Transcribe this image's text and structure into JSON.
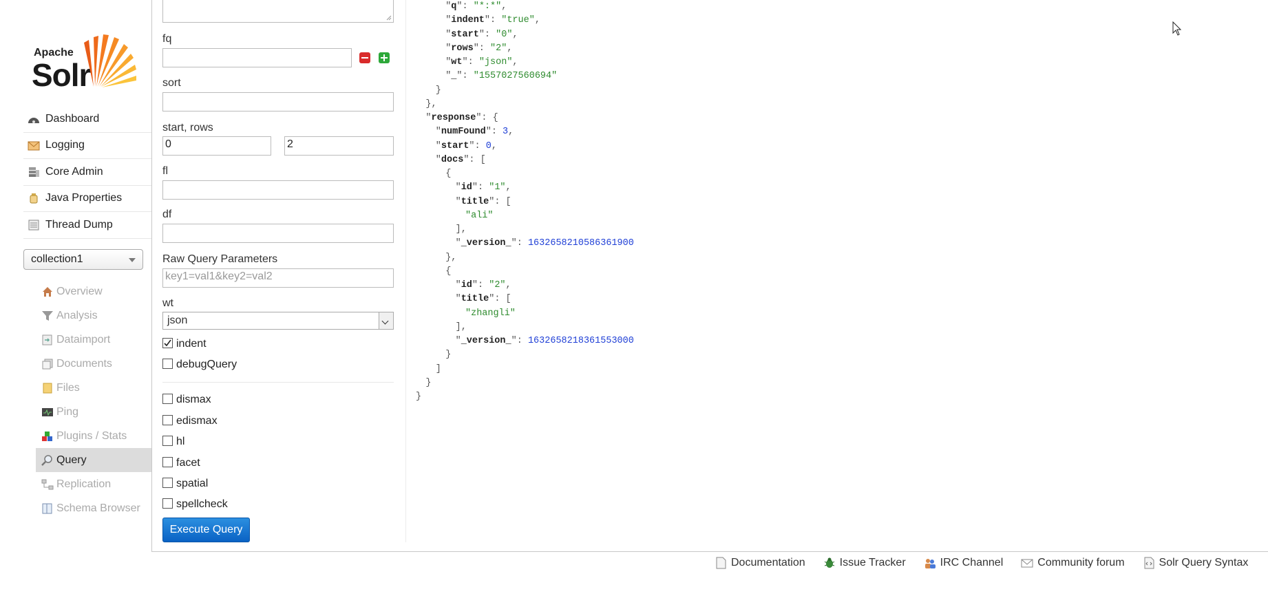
{
  "logo": {
    "line1": "Apache",
    "line2": "Solr"
  },
  "main_nav": [
    {
      "label": "Dashboard",
      "icon": "dashboard-icon"
    },
    {
      "label": "Logging",
      "icon": "logging-icon"
    },
    {
      "label": "Core Admin",
      "icon": "core-admin-icon"
    },
    {
      "label": "Java Properties",
      "icon": "java-properties-icon"
    },
    {
      "label": "Thread Dump",
      "icon": "thread-dump-icon"
    }
  ],
  "core_selector": {
    "value": "collection1"
  },
  "core_menu": [
    {
      "label": "Overview",
      "icon": "home-icon",
      "active": false
    },
    {
      "label": "Analysis",
      "icon": "funnel-icon",
      "active": false
    },
    {
      "label": "Dataimport",
      "icon": "dataimport-icon",
      "active": false
    },
    {
      "label": "Documents",
      "icon": "documents-icon",
      "active": false
    },
    {
      "label": "Files",
      "icon": "files-icon",
      "active": false
    },
    {
      "label": "Ping",
      "icon": "ping-icon",
      "active": false
    },
    {
      "label": "Plugins / Stats",
      "icon": "plugins-icon",
      "active": false
    },
    {
      "label": "Query",
      "icon": "magnifier-icon",
      "active": true
    },
    {
      "label": "Replication",
      "icon": "replication-icon",
      "active": false
    },
    {
      "label": "Schema Browser",
      "icon": "schema-icon",
      "active": false
    }
  ],
  "form": {
    "fq_label": "fq",
    "fq_value": "",
    "sort_label": "sort",
    "sort_value": "",
    "start_rows_label": "start, rows",
    "start_value": "0",
    "rows_value": "2",
    "fl_label": "fl",
    "fl_value": "",
    "df_label": "df",
    "df_value": "",
    "raw_label": "Raw Query Parameters",
    "raw_placeholder": "key1=val1&key2=val2",
    "wt_label": "wt",
    "wt_value": "json",
    "checkboxes": [
      {
        "label": "indent",
        "checked": true
      },
      {
        "label": "debugQuery",
        "checked": false
      }
    ],
    "options": [
      {
        "label": "dismax",
        "checked": false
      },
      {
        "label": "edismax",
        "checked": false
      },
      {
        "label": "hl",
        "checked": false
      },
      {
        "label": "facet",
        "checked": false
      },
      {
        "label": "spatial",
        "checked": false
      },
      {
        "label": "spellcheck",
        "checked": false
      }
    ],
    "execute_label": "Execute Query"
  },
  "response_lines": [
    {
      "indent": 3,
      "k": "q",
      "v": "\"*:*\"",
      "vt": "s",
      "tail": ","
    },
    {
      "indent": 3,
      "k": "indent",
      "v": "\"true\"",
      "vt": "s",
      "tail": ","
    },
    {
      "indent": 3,
      "k": "start",
      "v": "\"0\"",
      "vt": "s",
      "tail": ","
    },
    {
      "indent": 3,
      "k": "rows",
      "v": "\"2\"",
      "vt": "s",
      "tail": ","
    },
    {
      "indent": 3,
      "k": "wt",
      "v": "\"json\"",
      "vt": "s",
      "tail": ","
    },
    {
      "indent": 3,
      "k": "_",
      "v": "\"1557027560694\"",
      "vt": "s",
      "tail": ""
    },
    {
      "indent": 2,
      "raw": "}"
    },
    {
      "indent": 1,
      "raw": "},"
    },
    {
      "indent": 1,
      "k": "response",
      "v": "{",
      "vt": "p",
      "tail": ""
    },
    {
      "indent": 2,
      "k": "numFound",
      "v": "3",
      "vt": "n",
      "tail": ","
    },
    {
      "indent": 2,
      "k": "start",
      "v": "0",
      "vt": "n",
      "tail": ","
    },
    {
      "indent": 2,
      "k": "docs",
      "v": "[",
      "vt": "p",
      "tail": ""
    },
    {
      "indent": 3,
      "raw": "{"
    },
    {
      "indent": 4,
      "k": "id",
      "v": "\"1\"",
      "vt": "s",
      "tail": ","
    },
    {
      "indent": 4,
      "k": "title",
      "v": "[",
      "vt": "p",
      "tail": ""
    },
    {
      "indent": 5,
      "s": "\"ali\""
    },
    {
      "indent": 4,
      "raw": "],"
    },
    {
      "indent": 4,
      "k": "_version_",
      "v": "1632658210586361900",
      "vt": "n",
      "tail": ""
    },
    {
      "indent": 3,
      "raw": "},"
    },
    {
      "indent": 3,
      "raw": "{"
    },
    {
      "indent": 4,
      "k": "id",
      "v": "\"2\"",
      "vt": "s",
      "tail": ","
    },
    {
      "indent": 4,
      "k": "title",
      "v": "[",
      "vt": "p",
      "tail": ""
    },
    {
      "indent": 5,
      "s": "\"zhangli\""
    },
    {
      "indent": 4,
      "raw": "],"
    },
    {
      "indent": 4,
      "k": "_version_",
      "v": "1632658218361553000",
      "vt": "n",
      "tail": ""
    },
    {
      "indent": 3,
      "raw": "}"
    },
    {
      "indent": 2,
      "raw": "]"
    },
    {
      "indent": 1,
      "raw": "}"
    },
    {
      "indent": 0,
      "raw": "}"
    }
  ],
  "footer": [
    {
      "label": "Documentation",
      "icon": "documentation-icon"
    },
    {
      "label": "Issue Tracker",
      "icon": "bug-icon"
    },
    {
      "label": "IRC Channel",
      "icon": "irc-icon"
    },
    {
      "label": "Community forum",
      "icon": "mail-icon"
    },
    {
      "label": "Solr Query Syntax",
      "icon": "syntax-icon"
    }
  ]
}
